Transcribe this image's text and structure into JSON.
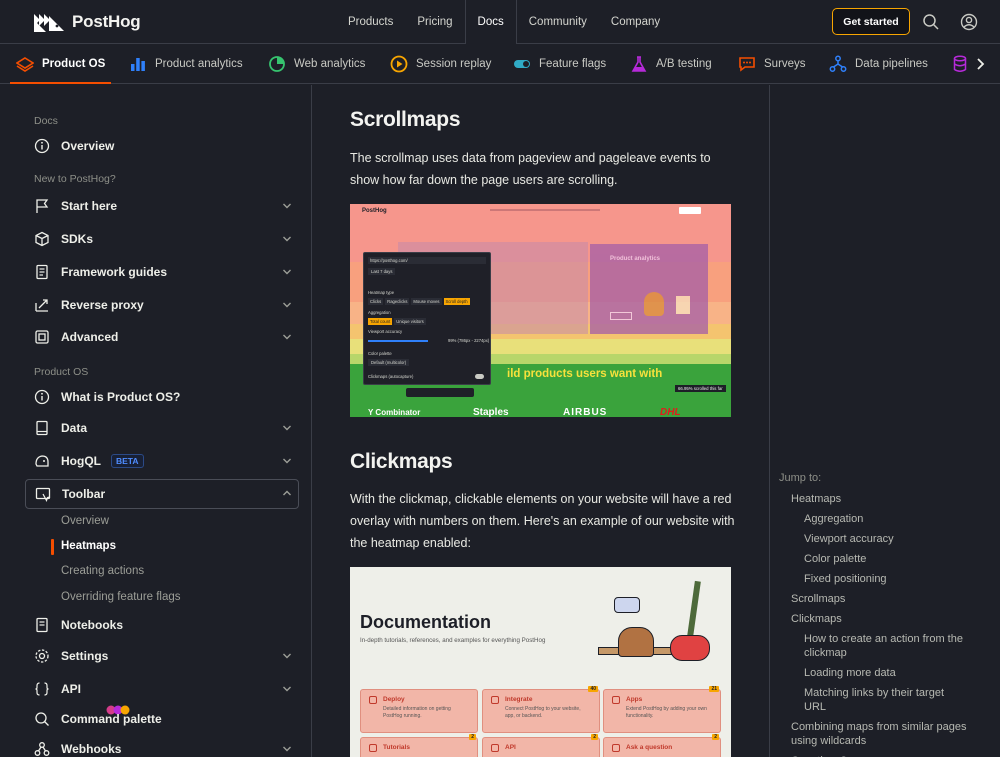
{
  "brand": {
    "name": "PostHog"
  },
  "topnav": {
    "items": [
      "Products",
      "Pricing",
      "Docs",
      "Community",
      "Company"
    ],
    "active": "Docs",
    "cta": "Get started"
  },
  "products": [
    {
      "label": "Product OS",
      "icon": "product-os-icon",
      "color": "#f54e00"
    },
    {
      "label": "Product analytics",
      "icon": "bar-chart-icon",
      "color": "#2f80fa"
    },
    {
      "label": "Web analytics",
      "icon": "pie-chart-icon",
      "color": "#36c46f"
    },
    {
      "label": "Session replay",
      "icon": "play-icon",
      "color": "#f7a501"
    },
    {
      "label": "Feature flags",
      "icon": "toggle-icon",
      "color": "#30abc6"
    },
    {
      "label": "A/B testing",
      "icon": "flask-icon",
      "color": "#b62ad9"
    },
    {
      "label": "Surveys",
      "icon": "chat-icon",
      "color": "#f54e00"
    },
    {
      "label": "Data pipelines",
      "icon": "pipeline-icon",
      "color": "#2f80fa"
    }
  ],
  "sidebar": {
    "docs_heading": "Docs",
    "overview": "Overview",
    "new_heading": "New to PostHog?",
    "new_items": [
      "Start here",
      "SDKs",
      "Framework guides",
      "Reverse proxy",
      "Advanced"
    ],
    "productos_heading": "Product OS",
    "productos_items": [
      "What is Product OS?",
      "Data",
      "HogQL",
      "Toolbar",
      "Notebooks",
      "Settings",
      "API",
      "Command palette",
      "Webhooks"
    ],
    "beta": "BETA",
    "toolbar_sub": [
      "Overview",
      "Heatmaps",
      "Creating actions",
      "Overriding feature flags"
    ]
  },
  "content": {
    "scroll_title": "Scrollmaps",
    "scroll_text": "The scrollmap uses data from pageview and pageleave events to show how far down the page users are scrolling.",
    "click_title": "Clickmaps",
    "click_text": "With the clickmap, clickable elements on your website will have a red overlay with numbers on them. Here's an example of our website with the heatmap enabled:"
  },
  "scrollshot": {
    "logo": "PostHog",
    "url": "https://posthog.com/",
    "range": "Last 7 days",
    "heatmap_type_label": "Heatmap type",
    "types": [
      "Clicks",
      "Rageclicks",
      "Mouse moves",
      "Scroll depth"
    ],
    "aggregation_label": "Aggregation",
    "aggregation": [
      "Total count",
      "Unique visitors"
    ],
    "viewport_label": "Viewport accuracy",
    "viewport_value": "99% (786px - 2274px)",
    "palette_label": "Color palette",
    "palette_value": "Default (multicolor)",
    "clickmaps_label": "Clickmaps (autocapture)",
    "panel_title": "Product analytics",
    "headline": "ild products users want with",
    "scrolled_note": "66.95% scrolled this far",
    "logos": [
      "Y Combinator",
      "Staples",
      "AIRBUS",
      "DHL"
    ],
    "bands": [
      "#f6968c",
      "#f8a07e",
      "#f8b387",
      "#f4c46f",
      "#e8e07a",
      "#b8d66a",
      "#3aa33c"
    ]
  },
  "clickshot": {
    "title": "Documentation",
    "subtitle": "In-depth tutorials, references, and examples for everything PostHog",
    "cards": [
      {
        "title": "Deploy",
        "text": "Detailed information on getting PostHog running.",
        "count": ""
      },
      {
        "title": "Integrate",
        "text": "Connect PostHog to your website, app, or backend.",
        "count": "40"
      },
      {
        "title": "Apps",
        "text": "Extend PostHog by adding your own functionality.",
        "count": "21"
      },
      {
        "title": "Tutorials",
        "text": "",
        "count": "2"
      },
      {
        "title": "API",
        "text": "",
        "count": "2"
      },
      {
        "title": "Ask a question",
        "text": "",
        "count": "2"
      }
    ]
  },
  "toc": {
    "title": "Jump to:",
    "items": [
      {
        "label": "Heatmaps",
        "level": 1
      },
      {
        "label": "Aggregation",
        "level": 2
      },
      {
        "label": "Viewport accuracy",
        "level": 2
      },
      {
        "label": "Color palette",
        "level": 2
      },
      {
        "label": "Fixed positioning",
        "level": 2
      },
      {
        "label": "Scrollmaps",
        "level": 1
      },
      {
        "label": "Clickmaps",
        "level": 1
      },
      {
        "label": "How to create an action from the clickmap",
        "level": 2
      },
      {
        "label": "Loading more data",
        "level": 2
      },
      {
        "label": "Matching links by their target URL",
        "level": 2
      },
      {
        "label": "Combining maps from similar pages using wildcards",
        "level": 1
      },
      {
        "label": "Questions?",
        "level": 1
      }
    ]
  }
}
